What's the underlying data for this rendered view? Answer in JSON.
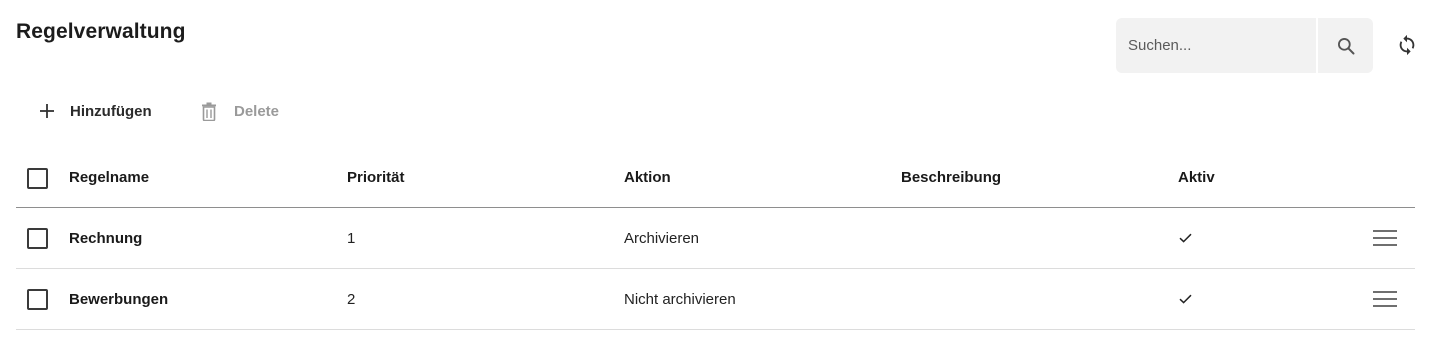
{
  "header": {
    "title": "Regelverwaltung"
  },
  "search": {
    "placeholder": "Suchen..."
  },
  "toolbar": {
    "add_label": "Hinzufügen",
    "delete_label": "Delete"
  },
  "table": {
    "columns": [
      "Regelname",
      "Priorität",
      "Aktion",
      "Beschreibung",
      "Aktiv"
    ],
    "rows": [
      {
        "name": "Rechnung",
        "priority": "1",
        "action": "Archivieren",
        "description": "",
        "active": true
      },
      {
        "name": "Bewerbungen",
        "priority": "2",
        "action": "Nicht archivieren",
        "description": "",
        "active": true
      }
    ]
  },
  "colors": {
    "header_divider": "#8e8e8e",
    "row_divider": "#dcdcdc",
    "search_bg": "#f2f2f2",
    "disabled_text": "#9a9a9a"
  },
  "icons": {
    "add": "plus-icon",
    "delete": "trash-icon",
    "search": "search-icon",
    "refresh": "refresh-icon",
    "active": "checkmark-icon",
    "row_menu": "drag-handle-icon"
  }
}
